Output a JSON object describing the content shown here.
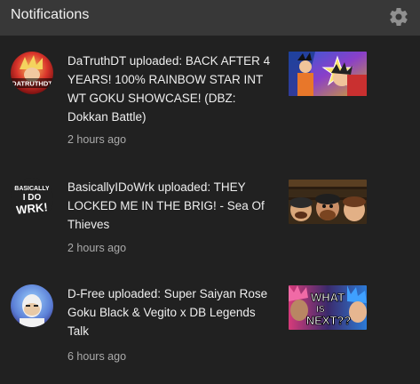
{
  "header": {
    "title": "Notifications"
  },
  "notifications": [
    {
      "channel": "DaTruthDT",
      "text": "DaTruthDT uploaded: BACK AFTER 4 YEARS! 100% RAINBOW STAR INT WT GOKU SHOWCASE! (DBZ: Dokkan Battle)",
      "time": "2 hours ago",
      "avatar_text": "DATRUTHDT"
    },
    {
      "channel": "BasicallyIDoWrk",
      "text": "BasicallyIDoWrk uploaded: THEY LOCKED ME IN THE BRIG! - Sea Of Thieves",
      "time": "2 hours ago",
      "avatar_text": [
        "BASICALLY",
        "I DO",
        "WRK!"
      ]
    },
    {
      "channel": "D-Free",
      "text": "D-Free uploaded: Super Saiyan Rose Goku Black & Vegito x DB Legends Talk",
      "time": "6 hours ago",
      "thumb_text": [
        "WHAT",
        "IS",
        "NEXT??"
      ]
    }
  ]
}
